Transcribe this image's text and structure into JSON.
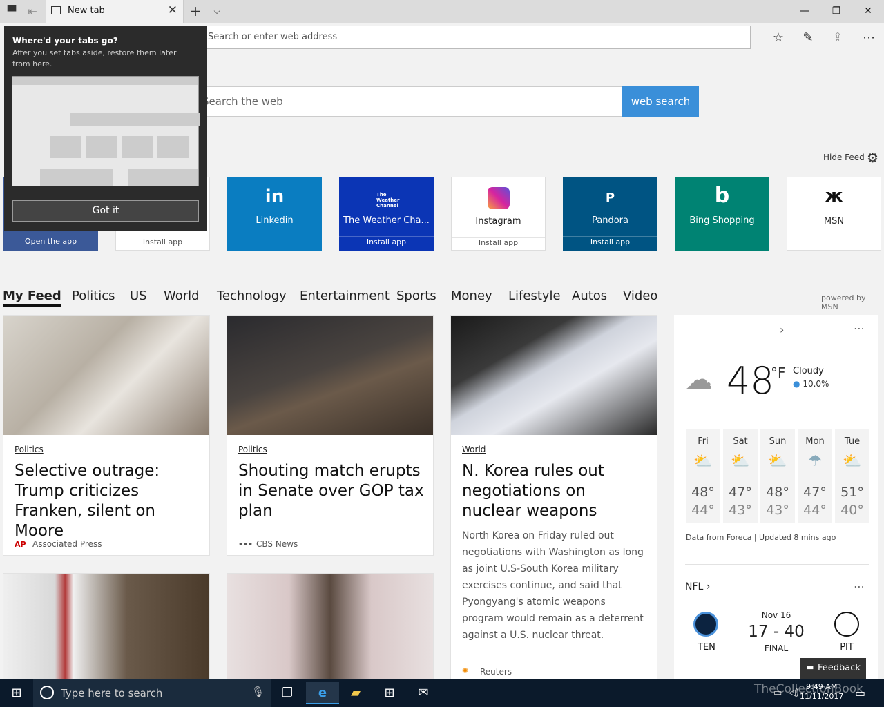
{
  "window": {
    "tab_title": "New tab"
  },
  "address_bar": {
    "placeholder": "Search or enter web address"
  },
  "search": {
    "placeholder": "Search the web",
    "button": "web search"
  },
  "hide_feed": "Hide Feed",
  "tiles": [
    {
      "name": "",
      "action": "Open the app"
    },
    {
      "name": "",
      "action": "Install app"
    },
    {
      "name": "Linkedin",
      "action": "",
      "logo": "in"
    },
    {
      "name": "The Weather Cha...",
      "action": "Install app",
      "logo": "The Weather Channel"
    },
    {
      "name": "Instagram",
      "action": "Install app"
    },
    {
      "name": "Pandora",
      "action": "Install app",
      "logo": "P"
    },
    {
      "name": "Bing Shopping",
      "action": ""
    },
    {
      "name": "MSN",
      "action": ""
    }
  ],
  "feed_nav": [
    "My Feed",
    "Politics",
    "US",
    "World",
    "Technology",
    "Entertainment",
    "Sports",
    "Money",
    "Lifestyle",
    "Autos",
    "Video"
  ],
  "powered_by": "powered by MSN",
  "articles": [
    {
      "category": "Politics",
      "headline": "Selective outrage: Trump criticizes Franken, silent on Moore",
      "source": "Associated Press",
      "source_mark": "AP"
    },
    {
      "category": "Politics",
      "headline": "Shouting match erupts in Senate over GOP tax plan",
      "source": "CBS News",
      "source_mark": "•••"
    },
    {
      "category": "World",
      "headline": "N. Korea rules out negotiations on nuclear weapons",
      "body": "North Korea on Friday ruled out negotiations with Washington as long as joint U.S-South Korea military exercises continue, and said that Pyongyang's atomic weapons program would remain as a deterrent against a U.S. nuclear threat.",
      "source": "Reuters"
    }
  ],
  "weather": {
    "temp": "48",
    "unit": "°F",
    "condition": "Cloudy",
    "precip": "10.0%",
    "forecast": [
      {
        "day": "Fri",
        "hi": "48°",
        "lo": "44°"
      },
      {
        "day": "Sat",
        "hi": "47°",
        "lo": "43°"
      },
      {
        "day": "Sun",
        "hi": "48°",
        "lo": "43°"
      },
      {
        "day": "Mon",
        "hi": "47°",
        "lo": "44°"
      },
      {
        "day": "Tue",
        "hi": "51°",
        "lo": "40°"
      }
    ],
    "attribution": "Data from Foreca | Updated 8 mins ago"
  },
  "nfl": {
    "title": "NFL",
    "date": "Nov 16",
    "score": "17 - 40",
    "status": "FINAL",
    "home": "TEN",
    "away": "PIT"
  },
  "popup": {
    "title": "Where'd your tabs go?",
    "desc": "After you set tabs aside, restore them later from here.",
    "button": "Got it"
  },
  "feedback": "Feedback",
  "taskbar": {
    "search_placeholder": "Type here to search",
    "time": "9:49 AM",
    "date": "11/11/2017"
  },
  "watermark": "TheCollectionBook"
}
